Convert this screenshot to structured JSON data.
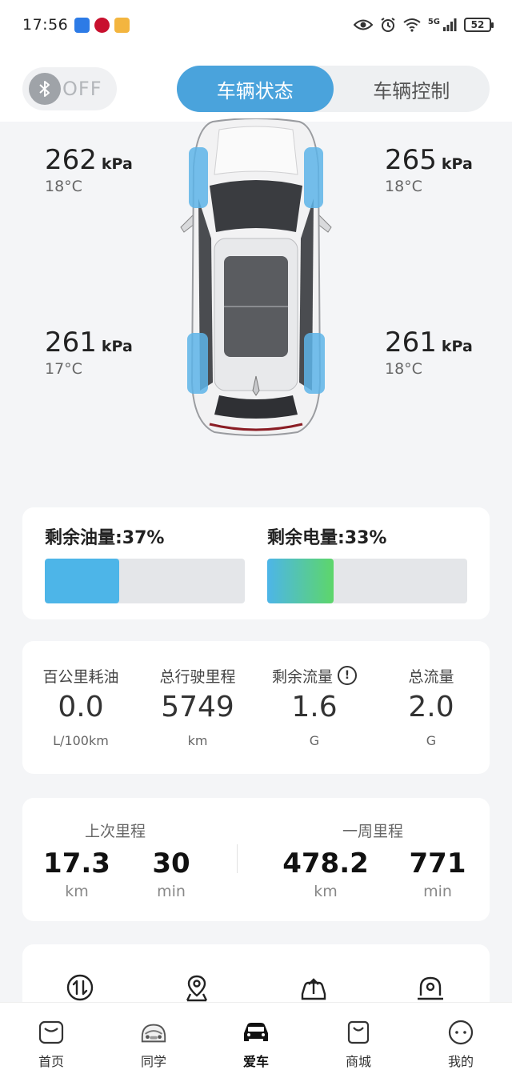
{
  "status_bar": {
    "time": "17:56",
    "battery": "52",
    "network": "5G"
  },
  "header": {
    "bluetooth_state": "OFF",
    "tabs": [
      {
        "label": "车辆状态",
        "active": true
      },
      {
        "label": "车辆控制",
        "active": false
      }
    ]
  },
  "tires": {
    "front_left": {
      "pressure": "262",
      "unit": "kPa",
      "temp": "18°C"
    },
    "front_right": {
      "pressure": "265",
      "unit": "kPa",
      "temp": "18°C"
    },
    "rear_left": {
      "pressure": "261",
      "unit": "kPa",
      "temp": "17°C"
    },
    "rear_right": {
      "pressure": "261",
      "unit": "kPa",
      "temp": "18°C"
    }
  },
  "levels": {
    "fuel": {
      "label": "剩余油量:37%",
      "percent": 37,
      "color": "#4db5e8"
    },
    "battery": {
      "label": "剩余电量:33%",
      "percent": 33,
      "gradient_from": "#4db5e8",
      "gradient_to": "#5dd66a"
    }
  },
  "stats": [
    {
      "label": "百公里耗油",
      "value": "0.0",
      "unit": "L/100km",
      "info": false
    },
    {
      "label": "总行驶里程",
      "value": "5749",
      "unit": "km",
      "info": false
    },
    {
      "label": "剩余流量",
      "value": "1.6",
      "unit": "G",
      "info": true
    },
    {
      "label": "总流量",
      "value": "2.0",
      "unit": "G",
      "info": false
    }
  ],
  "mileage": {
    "last_trip": {
      "title": "上次里程",
      "distance": "17.3",
      "distance_unit": "km",
      "duration": "30",
      "duration_unit": "min"
    },
    "week": {
      "title": "一周里程",
      "distance": "478.2",
      "distance_unit": "km",
      "duration": "771",
      "duration_unit": "min"
    }
  },
  "shortcuts": [
    {
      "icon": "swap-arrows-icon"
    },
    {
      "icon": "location-pin-icon"
    },
    {
      "icon": "car-upload-icon"
    },
    {
      "icon": "dome-light-icon"
    }
  ],
  "bottom_nav": [
    {
      "label": "首页",
      "icon": "home-icon",
      "active": false
    },
    {
      "label": "同学",
      "icon": "classmates-car-icon",
      "active": false
    },
    {
      "label": "爱车",
      "icon": "car-icon",
      "active": true
    },
    {
      "label": "商城",
      "icon": "shopping-bag-icon",
      "active": false
    },
    {
      "label": "我的",
      "icon": "profile-face-icon",
      "active": false
    }
  ],
  "colors": {
    "accent": "#4aa3dc",
    "tire_highlight": "#5db4e8"
  }
}
